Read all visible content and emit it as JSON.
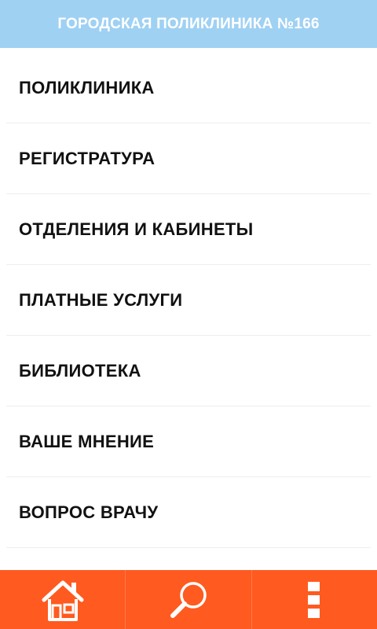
{
  "header": {
    "title": "ГОРОДСКАЯ ПОЛИКЛИНИКА №166"
  },
  "menu": {
    "items": [
      {
        "label": "ПОЛИКЛИНИКА"
      },
      {
        "label": "РЕГИСТРАТУРА"
      },
      {
        "label": "ОТДЕЛЕНИЯ И КАБИНЕТЫ"
      },
      {
        "label": "ПЛАТНЫЕ УСЛУГИ"
      },
      {
        "label": "БИБЛИОТЕКА"
      },
      {
        "label": "ВАШЕ МНЕНИЕ"
      },
      {
        "label": "ВОПРОС ВРАЧУ"
      }
    ]
  },
  "bottom_nav": {
    "buttons": [
      {
        "icon": "home-icon"
      },
      {
        "icon": "search-icon"
      },
      {
        "icon": "more-vertical-icon"
      }
    ]
  },
  "colors": {
    "header_bg": "#9fd1f3",
    "bottom_bar_bg": "#ff5a1f",
    "text": "#111111"
  }
}
